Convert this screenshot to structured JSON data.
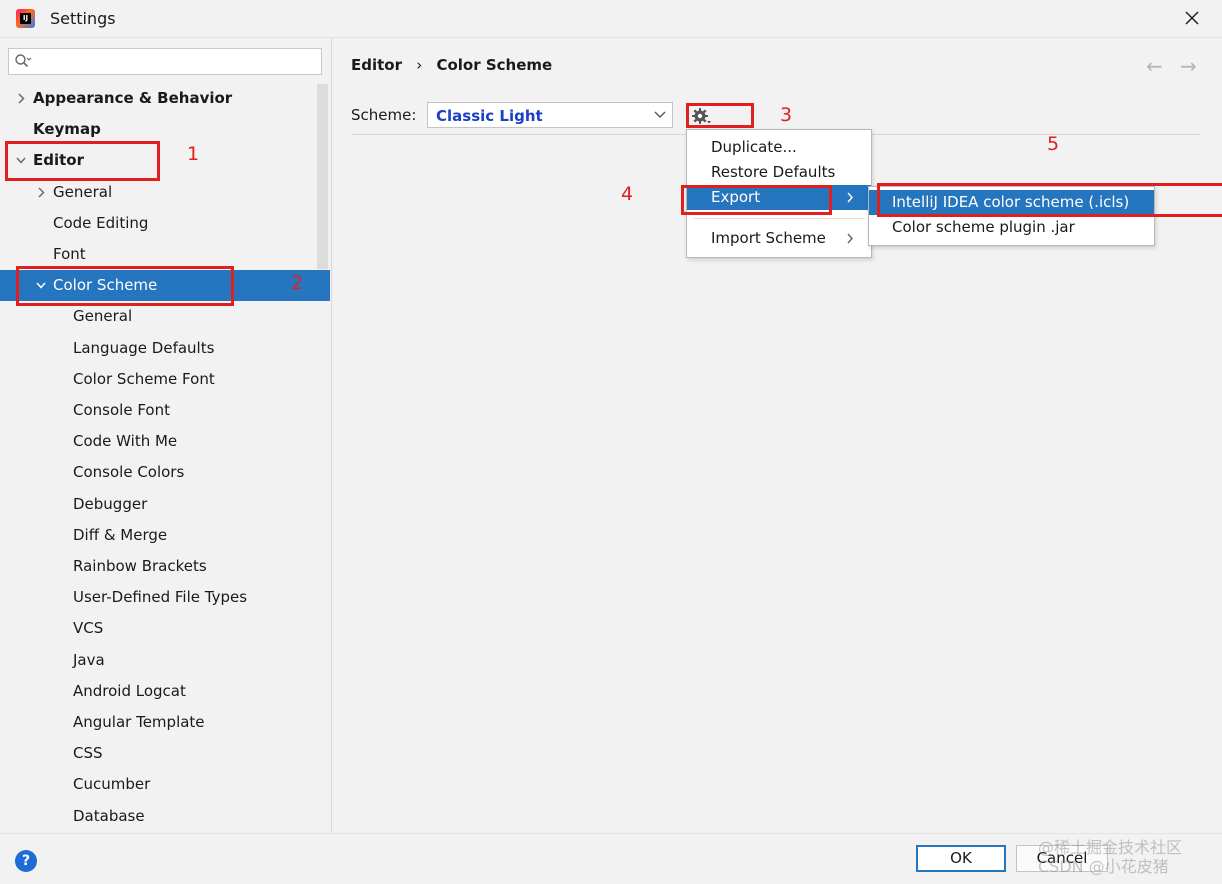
{
  "window": {
    "title": "Settings",
    "app_icon_text": "IJ"
  },
  "sidebar": {
    "search": {
      "placeholder": ""
    },
    "items": [
      {
        "label": "Appearance & Behavior",
        "level": 0,
        "expander": "collapsed",
        "bold": true
      },
      {
        "label": "Keymap",
        "level": 0,
        "expander": "none",
        "bold": true
      },
      {
        "label": "Editor",
        "level": 0,
        "expander": "expanded",
        "bold": true
      },
      {
        "label": "General",
        "level": 1,
        "expander": "collapsed"
      },
      {
        "label": "Code Editing",
        "level": 1,
        "expander": "none"
      },
      {
        "label": "Font",
        "level": 1,
        "expander": "none"
      },
      {
        "label": "Color Scheme",
        "level": 1,
        "expander": "expanded",
        "selected": true
      },
      {
        "label": "General",
        "level": 2,
        "expander": "none"
      },
      {
        "label": "Language Defaults",
        "level": 2,
        "expander": "none"
      },
      {
        "label": "Color Scheme Font",
        "level": 2,
        "expander": "none"
      },
      {
        "label": "Console Font",
        "level": 2,
        "expander": "none"
      },
      {
        "label": "Code With Me",
        "level": 2,
        "expander": "none"
      },
      {
        "label": "Console Colors",
        "level": 2,
        "expander": "none"
      },
      {
        "label": "Debugger",
        "level": 2,
        "expander": "none"
      },
      {
        "label": "Diff & Merge",
        "level": 2,
        "expander": "none"
      },
      {
        "label": "Rainbow Brackets",
        "level": 2,
        "expander": "none"
      },
      {
        "label": "User-Defined File Types",
        "level": 2,
        "expander": "none"
      },
      {
        "label": "VCS",
        "level": 2,
        "expander": "none"
      },
      {
        "label": "Java",
        "level": 2,
        "expander": "none"
      },
      {
        "label": "Android Logcat",
        "level": 2,
        "expander": "none"
      },
      {
        "label": "Angular Template",
        "level": 2,
        "expander": "none"
      },
      {
        "label": "CSS",
        "level": 2,
        "expander": "none"
      },
      {
        "label": "Cucumber",
        "level": 2,
        "expander": "none"
      },
      {
        "label": "Database",
        "level": 2,
        "expander": "none"
      }
    ]
  },
  "main": {
    "breadcrumb": {
      "parent": "Editor",
      "separator": "›",
      "current": "Color Scheme"
    },
    "nav": {
      "back": "←",
      "forward": "→"
    },
    "scheme": {
      "label": "Scheme:",
      "value": "Classic Light"
    }
  },
  "gear_menu": {
    "items": [
      {
        "label": "Duplicate..."
      },
      {
        "label": "Restore Defaults"
      },
      {
        "label": "Export",
        "highlighted": true,
        "submenu": true
      },
      {
        "label": "Import Scheme",
        "submenu": true
      }
    ]
  },
  "export_submenu": {
    "items": [
      {
        "label": "IntelliJ IDEA color scheme (.icls)",
        "highlighted": true
      },
      {
        "label": "Color scheme plugin .jar"
      }
    ]
  },
  "annotations": {
    "numbers": [
      "1",
      "2",
      "3",
      "4",
      "5"
    ],
    "color": "#e02020"
  },
  "buttons": {
    "help": "?",
    "ok": "OK",
    "cancel": "Cancel"
  },
  "watermark": {
    "line1": "@稀土掘金技术社区",
    "line2": "CSDN @小花皮猪"
  },
  "colors": {
    "selection": "#2675bf",
    "scheme_value": "#1a3fc9",
    "window_bg": "#f2f2f2"
  }
}
